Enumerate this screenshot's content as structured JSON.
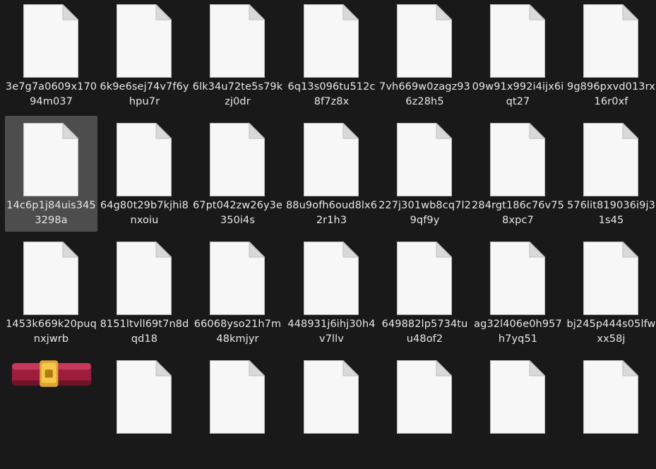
{
  "files": [
    {
      "name": "3e7g7a0609x17094m037",
      "type": "file-icon"
    },
    {
      "name": "6k9e6sej74v7f6yhpu7r",
      "type": "file-icon"
    },
    {
      "name": "6lk34u72te5s79kzj0dr",
      "type": "file-icon"
    },
    {
      "name": "6q13s096tu512c8f7z8x",
      "type": "file-icon"
    },
    {
      "name": "7vh669w0zagz936z28h5",
      "type": "file-icon"
    },
    {
      "name": "09w91x992i4ijx6iqt27",
      "type": "file-icon"
    },
    {
      "name": "9g896pxvd013rx16r0xf",
      "type": "file-icon"
    },
    {
      "name": "14c6p1j84uis3453298a",
      "type": "file-icon",
      "selected": true
    },
    {
      "name": "64g80t29b7kjhi8nxoiu",
      "type": "file-icon"
    },
    {
      "name": "67pt042zw26y3e350i4s",
      "type": "file-icon"
    },
    {
      "name": "88u9ofh6oud8lx62r1h3",
      "type": "file-icon"
    },
    {
      "name": "227j301wb8cq7l29qf9y",
      "type": "file-icon"
    },
    {
      "name": "284rgt186c76v758xpc7",
      "type": "file-icon"
    },
    {
      "name": "576lit819036i9j31s45",
      "type": "file-icon"
    },
    {
      "name": "1453k669k20puqnxjwrb",
      "type": "file-icon"
    },
    {
      "name": "8151ltvll69t7n8dqd18",
      "type": "file-icon"
    },
    {
      "name": "66068yso21h7m48kmjyr",
      "type": "file-icon"
    },
    {
      "name": "448931j6ihj30h4v7llv",
      "type": "file-icon"
    },
    {
      "name": "649882lp5734tuu48of2",
      "type": "file-icon"
    },
    {
      "name": "ag32l406e0h957h7yq51",
      "type": "file-icon"
    },
    {
      "name": "bj245p444s05lfwxx58j",
      "type": "file-icon"
    },
    {
      "name": "",
      "type": "archive-icon"
    },
    {
      "name": "",
      "type": "file-icon"
    },
    {
      "name": "",
      "type": "file-icon"
    },
    {
      "name": "",
      "type": "file-icon"
    },
    {
      "name": "",
      "type": "file-icon"
    },
    {
      "name": "",
      "type": "file-icon"
    },
    {
      "name": "",
      "type": "file-icon"
    }
  ],
  "colors": {
    "background": "#191919",
    "selection": "#4d4d4d",
    "text": "#e8e8e8",
    "doc_fill": "#f7f7f7"
  }
}
